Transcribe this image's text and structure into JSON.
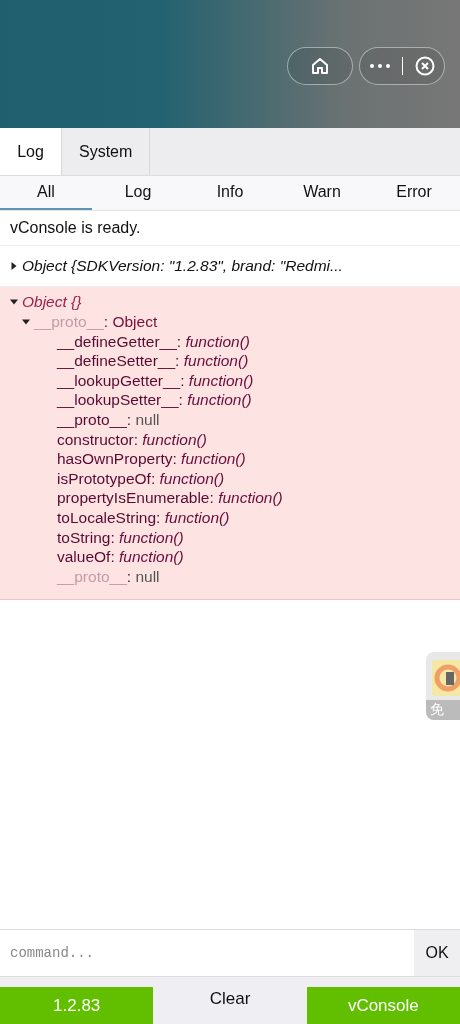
{
  "header": {
    "buttons": [
      {
        "kind": "home"
      },
      {
        "kind": "capsule"
      }
    ]
  },
  "tabs": [
    {
      "label": "Log",
      "selected": true
    },
    {
      "label": "System",
      "selected": false
    }
  ],
  "filters": [
    {
      "label": "All",
      "selected": true
    },
    {
      "label": "Log",
      "selected": false
    },
    {
      "label": "Info",
      "selected": false
    },
    {
      "label": "Warn",
      "selected": false
    },
    {
      "label": "Error",
      "selected": false
    }
  ],
  "logs": [
    {
      "kind": "text",
      "text": "vConsole is ready."
    },
    {
      "kind": "object",
      "expanded": false,
      "text": "Object {SDKVersion: \"1.2.83\", brand: \"Redmi..."
    },
    {
      "kind": "tree",
      "error": true,
      "node": {
        "key": "Object {}",
        "expanded": true,
        "children": [
          {
            "key": "__proto__",
            "sep": ":",
            "dim": true,
            "value": "Object",
            "kind": "object",
            "expanded": true,
            "children": [
              {
                "key": "__defineGetter__",
                "sep": ":",
                "dim": false,
                "value": "function()",
                "kind": "function"
              },
              {
                "key": "__defineSetter__",
                "sep": ":",
                "dim": false,
                "value": "function()",
                "kind": "function"
              },
              {
                "key": "__lookupGetter__",
                "sep": ":",
                "dim": false,
                "value": "function()",
                "kind": "function"
              },
              {
                "key": "__lookupSetter__",
                "sep": ":",
                "dim": false,
                "value": "function()",
                "kind": "function"
              },
              {
                "key": "__proto__",
                "sep": ":",
                "dim": false,
                "value": "null",
                "kind": "null"
              },
              {
                "key": "constructor",
                "sep": ":",
                "dim": false,
                "value": "function()",
                "kind": "function"
              },
              {
                "key": "hasOwnProperty",
                "sep": ":",
                "dim": false,
                "value": "function()",
                "kind": "function"
              },
              {
                "key": "isPrototypeOf",
                "sep": ":",
                "dim": false,
                "value": "function()",
                "kind": "function"
              },
              {
                "key": "propertyIsEnumerable",
                "sep": ":",
                "dim": false,
                "value": "function()",
                "kind": "function"
              },
              {
                "key": "toLocaleString",
                "sep": ":",
                "dim": false,
                "value": "function()",
                "kind": "function"
              },
              {
                "key": "toString",
                "sep": ":",
                "dim": false,
                "value": "function()",
                "kind": "function"
              },
              {
                "key": "valueOf",
                "sep": ":",
                "dim": false,
                "value": "function()",
                "kind": "function"
              },
              {
                "key": "__proto__",
                "sep": ":",
                "dim": true,
                "value": "null",
                "kind": "null"
              }
            ]
          }
        ]
      }
    }
  ],
  "floating_widget": {
    "label": "免"
  },
  "command": {
    "placeholder": "command...",
    "button": "OK"
  },
  "toolbar": [
    {
      "label": "1.2.83",
      "kind": "green"
    },
    {
      "label": "Clear",
      "kind": "plain"
    },
    {
      "label": "vConsole",
      "kind": "green"
    }
  ]
}
